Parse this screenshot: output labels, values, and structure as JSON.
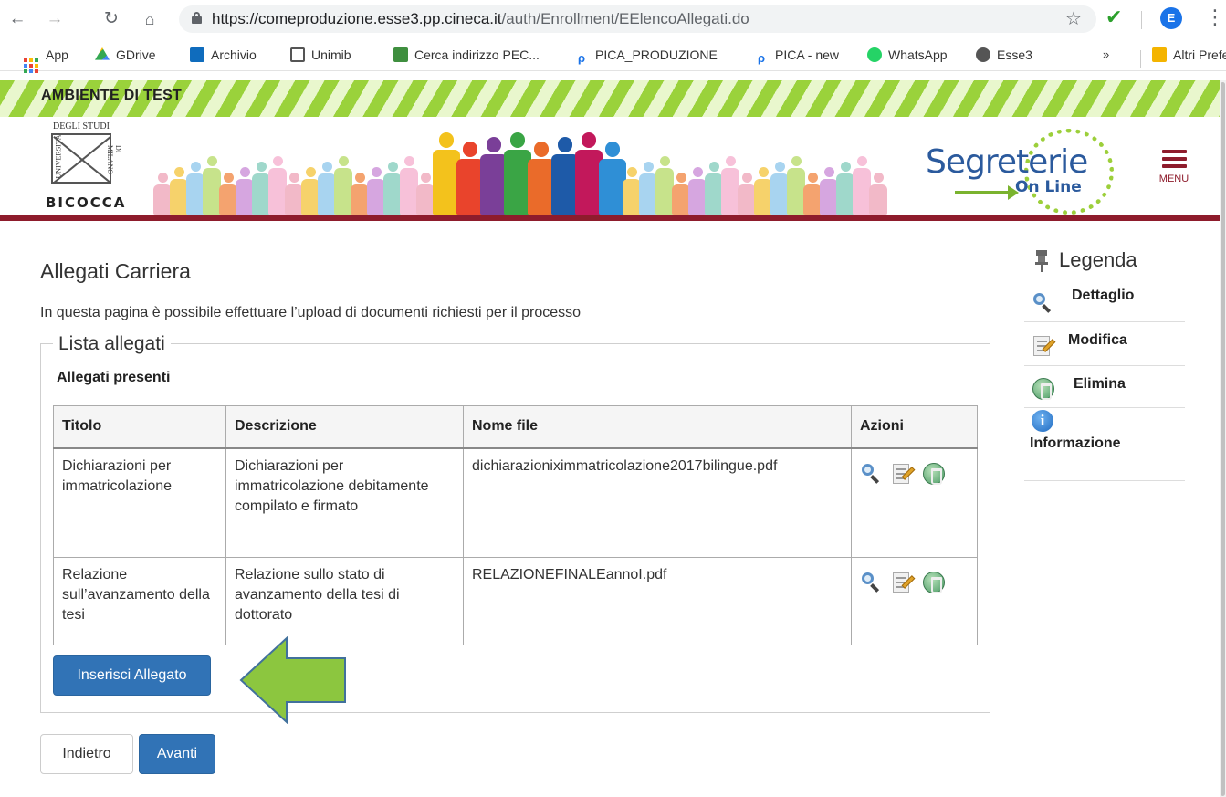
{
  "browser": {
    "url_host": "https://comeproduzione.esse3.pp.cineca.it",
    "url_path": "/auth/Enrollment/EElencoAllegati.do",
    "profile_initial": "E",
    "bookmarks": [
      {
        "label": "App"
      },
      {
        "label": "GDrive"
      },
      {
        "label": "Archivio"
      },
      {
        "label": "Unimib"
      },
      {
        "label": "Cerca indirizzo PEC..."
      },
      {
        "label": "PICA_PRODUZIONE"
      },
      {
        "label": "PICA - new"
      },
      {
        "label": "WhatsApp"
      },
      {
        "label": "Esse3"
      },
      {
        "label": "»"
      },
      {
        "label": "Altri Preferiti"
      }
    ]
  },
  "banner": {
    "test_env": "AMBIENTE DI TEST"
  },
  "header": {
    "logo_top": "DEGLI STUDI",
    "logo_left": "UNIVERSITÀ",
    "logo_right": "DI MILANO",
    "logo_bottom": "BICOCCA",
    "brand_word": "Segreterie",
    "brand_sub": "On Line",
    "menu_label": "MENU"
  },
  "page": {
    "title": "Allegati Carriera",
    "intro": "In questa pagina è possibile effettuare l’upload di documenti richiesti per il processo",
    "fieldset_legend": "Lista allegati",
    "subhead": "Allegati presenti",
    "columns": [
      "Titolo",
      "Descrizione",
      "Nome file",
      "Azioni"
    ],
    "rows": [
      {
        "titolo": "Dichiarazioni per immatricolazione",
        "descrizione": "Dichiarazioni per immatricolazione debitamente compilato e firmato",
        "nome_file": "dichiarazionixim­matricolazione2017bilingue.pdf"
      },
      {
        "titolo": "Relazione sull’avanzamento della tesi",
        "descrizione": "Relazione sullo stato di avanzamento della tesi di dottorato",
        "nome_file": "RELAZIONEFINALEannoI.pdf"
      }
    ],
    "insert_button": "Inserisci Allegato",
    "back_button": "Indietro",
    "next_button": "Avanti"
  },
  "legenda": {
    "title": "Legenda",
    "items": [
      {
        "label": "Dettaglio",
        "icon": "magnifier-icon"
      },
      {
        "label": "Modifica",
        "icon": "edit-icon"
      },
      {
        "label": "Elimina",
        "icon": "trash-icon"
      },
      {
        "label": "Informazione",
        "icon": "info-icon"
      }
    ]
  },
  "colors": {
    "brand_red": "#8e1c2c",
    "button_blue": "#3173b6",
    "test_green": "#9ad23b",
    "arrow_green": "#8cc63f"
  }
}
